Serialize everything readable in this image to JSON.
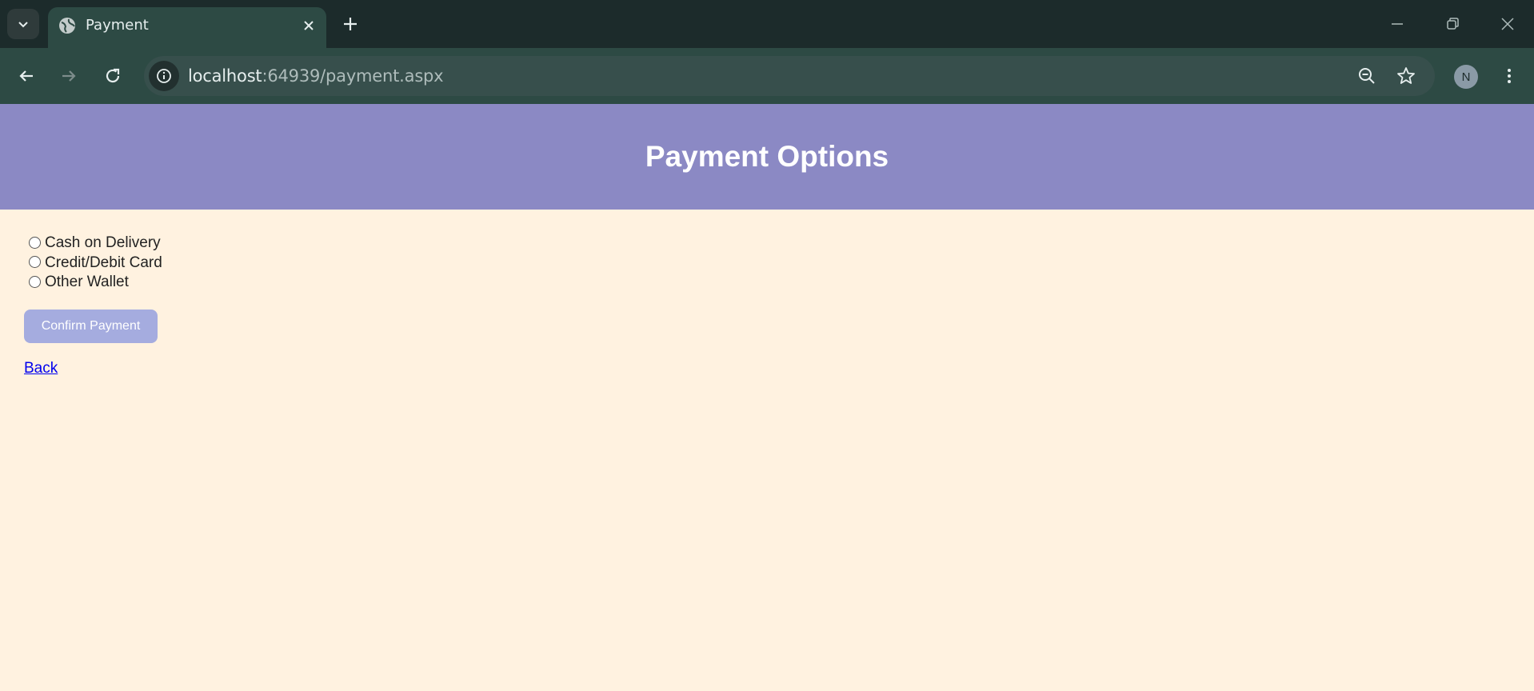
{
  "browser": {
    "tab": {
      "title": "Payment"
    },
    "address_bar": {
      "host": "localhost",
      "rest": ":64939/payment.aspx"
    },
    "profile_initial": "N"
  },
  "page": {
    "header": {
      "title": "Payment Options"
    },
    "payment_options": [
      {
        "label": "Cash on Delivery",
        "selected": false
      },
      {
        "label": "Credit/Debit Card",
        "selected": false
      },
      {
        "label": "Other Wallet",
        "selected": false
      }
    ],
    "confirm_button": {
      "label": "Confirm Payment"
    },
    "back_link": {
      "label": "Back"
    }
  },
  "colors": {
    "header_bg": "#8b89c4",
    "page_bg": "#fff2e0",
    "button_bg": "#a5acdf",
    "link": "#0000ee"
  },
  "icons": [
    "tab-search-icon",
    "globe-icon",
    "close-icon",
    "plus-icon",
    "minimize-icon",
    "restore-icon",
    "window-close-icon",
    "back-arrow-icon",
    "forward-arrow-icon",
    "reload-icon",
    "info-icon",
    "zoom-out-icon",
    "star-icon",
    "more-vert-icon"
  ]
}
